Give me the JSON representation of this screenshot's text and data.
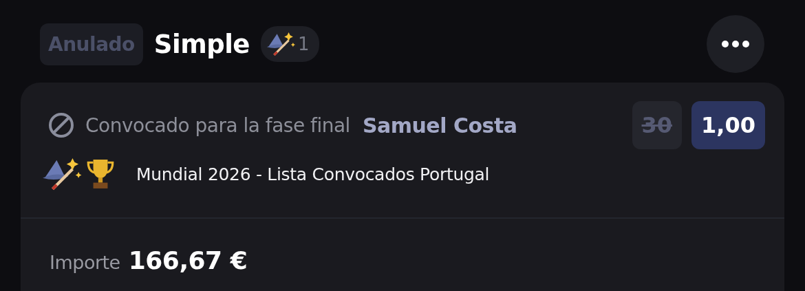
{
  "header": {
    "status_badge": "Anulado",
    "title": "Simple",
    "boost_count": "1"
  },
  "selection": {
    "market": "Convocado para la fase final",
    "player": "Samuel Costa",
    "event": "Mundial 2026 - Lista Convocados Portugal",
    "odds": [
      {
        "value": "30",
        "struck": true
      },
      {
        "value": "1,00",
        "struck": false
      }
    ]
  },
  "stake": {
    "label": "Importe",
    "amount": "166,67 €"
  }
}
